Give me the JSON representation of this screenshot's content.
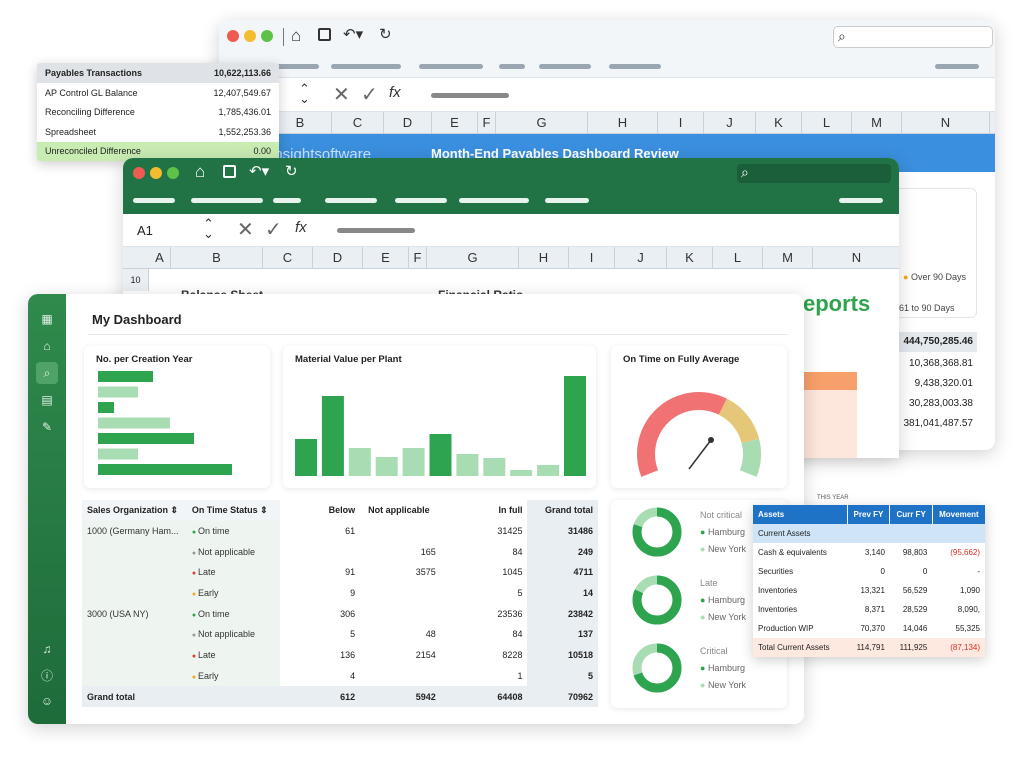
{
  "blue_window": {
    "title": "Month-End Payables Dashboard Review",
    "brand": "insightsoftware",
    "columns": [
      "B",
      "C",
      "D",
      "E",
      "F",
      "G",
      "H",
      "I",
      "J",
      "K",
      "L",
      "M",
      "N"
    ],
    "legend": [
      "Over 90 Days",
      "61 to 90 Days"
    ],
    "values": [
      "444,750,285.46",
      "10,368,368.81",
      "9,438,320.01",
      "30,283,003.38",
      "381,041,487.57"
    ],
    "reports_text": "eports",
    "chart_label": "THIS YEAR"
  },
  "payables": {
    "rows": [
      {
        "label": "Payables Transactions",
        "value": "10,622,113.66"
      },
      {
        "label": "AP Control GL Balance",
        "value": "12,407,549.67"
      },
      {
        "label": "Reconciling Difference",
        "value": "1,785,436.01"
      },
      {
        "label": "Spreadsheet",
        "value": "1,552,253.36"
      },
      {
        "label": "Unreconciled Difference",
        "value": "0.00"
      }
    ]
  },
  "green_window": {
    "cell_ref": "A1",
    "columns": [
      "A",
      "B",
      "C",
      "D",
      "E",
      "F",
      "G",
      "H",
      "I",
      "J",
      "K",
      "L",
      "M",
      "N"
    ],
    "row_number": "10",
    "balance_sheet": "Balance Sheet",
    "financial_ratio": "Financial Ratio"
  },
  "dashboard": {
    "title": "My Dashboard",
    "cards": {
      "creation_year": "No. per Creation Year",
      "material_value": "Material Value per Plant",
      "on_time": "On Time on Fully Average"
    },
    "table": {
      "headers": [
        "Sales Organization",
        "On Time Status",
        "Below",
        "Not applicable",
        "In full",
        "Grand total"
      ],
      "rows": [
        {
          "org": "1000 (Germany Ham...",
          "status": "On time",
          "color": "#2ea44f",
          "below": "61",
          "na": "",
          "full": "31425",
          "total": "31486"
        },
        {
          "org": "",
          "status": "Not applicable",
          "color": "#999999",
          "below": "",
          "na": "165",
          "full": "84",
          "total": "249"
        },
        {
          "org": "",
          "status": "Late",
          "color": "#e53935",
          "below": "91",
          "na": "3575",
          "full": "1045",
          "total": "4711"
        },
        {
          "org": "",
          "status": "Early",
          "color": "#f2a81d",
          "below": "9",
          "na": "",
          "full": "5",
          "total": "14"
        },
        {
          "org": "3000 (USA NY)",
          "status": "On time",
          "color": "#2ea44f",
          "below": "306",
          "na": "",
          "full": "23536",
          "total": "23842"
        },
        {
          "org": "",
          "status": "Not applicable",
          "color": "#999999",
          "below": "5",
          "na": "48",
          "full": "84",
          "total": "137"
        },
        {
          "org": "",
          "status": "Late",
          "color": "#e53935",
          "below": "136",
          "na": "2154",
          "full": "8228",
          "total": "10518"
        },
        {
          "org": "",
          "status": "Early",
          "color": "#f2a81d",
          "below": "4",
          "na": "",
          "full": "1",
          "total": "5"
        }
      ],
      "grand": {
        "label": "Grand total",
        "below": "612",
        "na": "5942",
        "full": "64408",
        "total": "70962"
      }
    },
    "donuts": [
      {
        "label": "Not critical",
        "a": "Hamburg",
        "b": "New York",
        "fraction": 0.8
      },
      {
        "label": "Late",
        "a": "Hamburg",
        "b": "New York",
        "fraction": 0.82
      },
      {
        "label": "Critical",
        "a": "Hamburg",
        "b": "New York",
        "fraction": 0.7
      }
    ]
  },
  "assets": {
    "headers": [
      "Assets",
      "Prev FY",
      "Curr FY",
      "Movement"
    ],
    "section": "Current Assets",
    "rows": [
      {
        "label": "Cash & equivalents",
        "prev": "3,140",
        "curr": "98,803",
        "move": "(95,662)",
        "neg": true
      },
      {
        "label": "Securities",
        "prev": "0",
        "curr": "0",
        "move": "-",
        "neg": false
      },
      {
        "label": "Inventories",
        "prev": "13,321",
        "curr": "56,529",
        "move": "1,090",
        "neg": false
      },
      {
        "label": "Inventories",
        "prev": "8,371",
        "curr": "28,529",
        "move": "8,090,",
        "neg": false
      },
      {
        "label": "Production WIP",
        "prev": "70,370",
        "curr": "14,046",
        "move": "55,325",
        "neg": false
      }
    ],
    "total": {
      "label": "Total Current Assets",
      "prev": "114,791",
      "curr": "111,925",
      "move": "(87,134)"
    }
  },
  "chart_data": [
    {
      "type": "bar",
      "title": "No. per Creation Year",
      "orientation": "horizontal",
      "values": [
        55,
        40,
        16,
        72,
        96,
        40,
        134
      ],
      "colors": [
        "#2ea44f",
        "#a8dcb2",
        "#2ea44f",
        "#a8dcb2",
        "#2ea44f",
        "#a8dcb2",
        "#2ea44f"
      ]
    },
    {
      "type": "bar",
      "title": "Material Value per Plant",
      "values": [
        37,
        80,
        28,
        19,
        28,
        42,
        22,
        18,
        6,
        11,
        100
      ],
      "colors": [
        "#2ea44f",
        "#2ea44f",
        "#a8dcb2",
        "#a8dcb2",
        "#a8dcb2",
        "#2ea44f",
        "#a8dcb2",
        "#a8dcb2",
        "#a8dcb2",
        "#a8dcb2",
        "#2ea44f"
      ]
    },
    {
      "type": "gauge",
      "title": "On Time on Fully Average",
      "needle_fraction": 0.62
    }
  ]
}
